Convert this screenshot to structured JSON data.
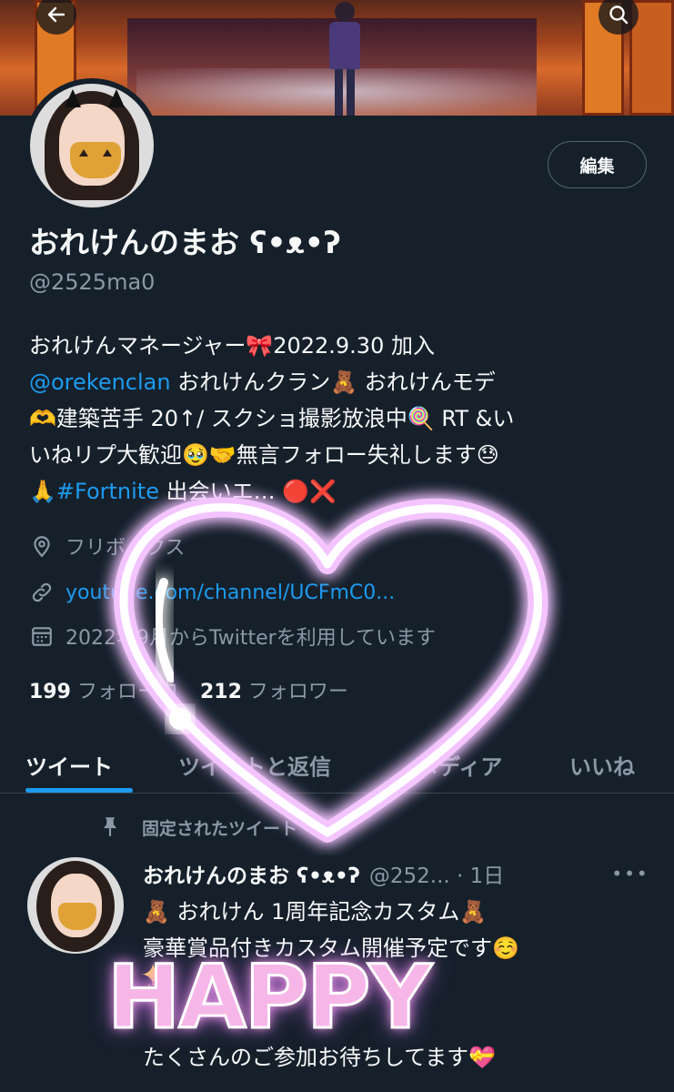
{
  "profile": {
    "display_name": "おれけんのまお ʕ•ᴥ•ʔ",
    "handle": "@2525ma0",
    "edit_label": "編集",
    "bio_lines": [
      "おれけんマネージャー🎀2022.9.30 加入",
      "",
      "🫶建築苦手 20↑/ スクショ撮影放浪中🍭 RT &い",
      "いねリプ大歓迎🥹🤝無言フォロー失礼します😓",
      ""
    ],
    "bio_line2_link": "@orekenclan",
    "bio_line2_text": " おれけんクラン🧸 おれけんモデ",
    "bio_line5_prefix": "🙏",
    "bio_line5_link": "#Fortnite",
    "bio_line5_text": " 出会いエ… 🔴❌",
    "location": "フリボックス",
    "url": "youtube.com/channel/UCFmC0...",
    "joined": "2022年9月からTwitterを利用しています",
    "following_count": "199",
    "following_label": "フォロー中",
    "followers_count": "212",
    "followers_label": "フォロワー"
  },
  "tabs": [
    {
      "label": "ツイート"
    },
    {
      "label": "ツイートと返信"
    },
    {
      "label": "メディア"
    },
    {
      "label": "いいね"
    }
  ],
  "tweet": {
    "pinned_label": "固定されたツイート",
    "name": "おれけんのまお ʕ•ᴥ•ʔ",
    "meta": "@252... · 1日",
    "lines": [
      "🧸 おれけん 1周年記念カスタム🧸",
      "豪華賞品付きカスタム開催予定です☺️",
      "✨",
      "",
      "たくさんのご参加お待ちしてます💝"
    ]
  },
  "overlay": {
    "sticker_text": "HAPPY"
  },
  "colors": {
    "background": "#15202b",
    "accent": "#1d9bf0",
    "secondary_text": "#8b98a5",
    "neon": "#f6b6e8"
  },
  "icons": [
    "back-arrow-icon",
    "search-icon",
    "location-pin-icon",
    "link-icon",
    "calendar-icon",
    "pin-icon",
    "more-dots-icon"
  ]
}
